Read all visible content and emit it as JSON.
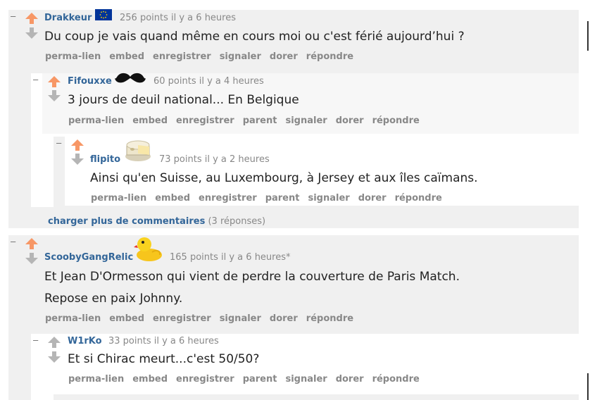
{
  "colors": {
    "upvote": "#f79766",
    "downvote": "#b5b5b5",
    "author": "#336699",
    "meta": "#888888",
    "panel_odd": "#f0f0f0",
    "panel_even": "#ffffff"
  },
  "icons": {
    "flag": "eu-flag-icon",
    "mustache": "mustache-icon",
    "cheese": "cheese-icon",
    "duck": "rubber-duck-icon"
  },
  "comments": [
    {
      "toggle": "–",
      "author": "Drakkeur",
      "meta": "256 points il y a 6 heures",
      "body": [
        "Du coup je vais quand même en cours moi ou c'est férié aujourd’hui ?"
      ],
      "buttons": [
        "perma-lien",
        "embed",
        "enregistrer",
        "signaler",
        "dorer",
        "répondre"
      ]
    },
    {
      "toggle": "–",
      "author": "Fifouxxe",
      "meta": "60 points il y a 4 heures",
      "body": [
        "3 jours de deuil national... En Belgique"
      ],
      "buttons": [
        "perma-lien",
        "embed",
        "enregistrer",
        "parent",
        "signaler",
        "dorer",
        "répondre"
      ]
    },
    {
      "toggle": "–",
      "author": "flipito",
      "meta": "73 points il y a 2 heures",
      "body": [
        "Ainsi qu'en Suisse, au Luxembourg, à Jersey et aux îles caïmans."
      ],
      "buttons": [
        "perma-lien",
        "embed",
        "enregistrer",
        "parent",
        "signaler",
        "dorer",
        "répondre"
      ]
    },
    {
      "toggle": "–",
      "author": "ScoobyGangRelic",
      "meta": "165 points il y a 6 heures*",
      "body": [
        "Et Jean D'Ormesson qui vient de perdre la couverture de Paris Match.",
        "Repose en paix Johnny."
      ],
      "buttons": [
        "perma-lien",
        "embed",
        "enregistrer",
        "signaler",
        "dorer",
        "répondre"
      ]
    },
    {
      "toggle": "–",
      "author": "W1rKo",
      "meta": "33 points il y a 6 heures",
      "body": [
        "Et si Chirac meurt...c'est 50/50?"
      ],
      "buttons": [
        "perma-lien",
        "embed",
        "enregistrer",
        "parent",
        "signaler",
        "dorer",
        "répondre"
      ]
    }
  ],
  "load_more": {
    "label": "charger plus de commentaires",
    "count": "(3 réponses)"
  }
}
